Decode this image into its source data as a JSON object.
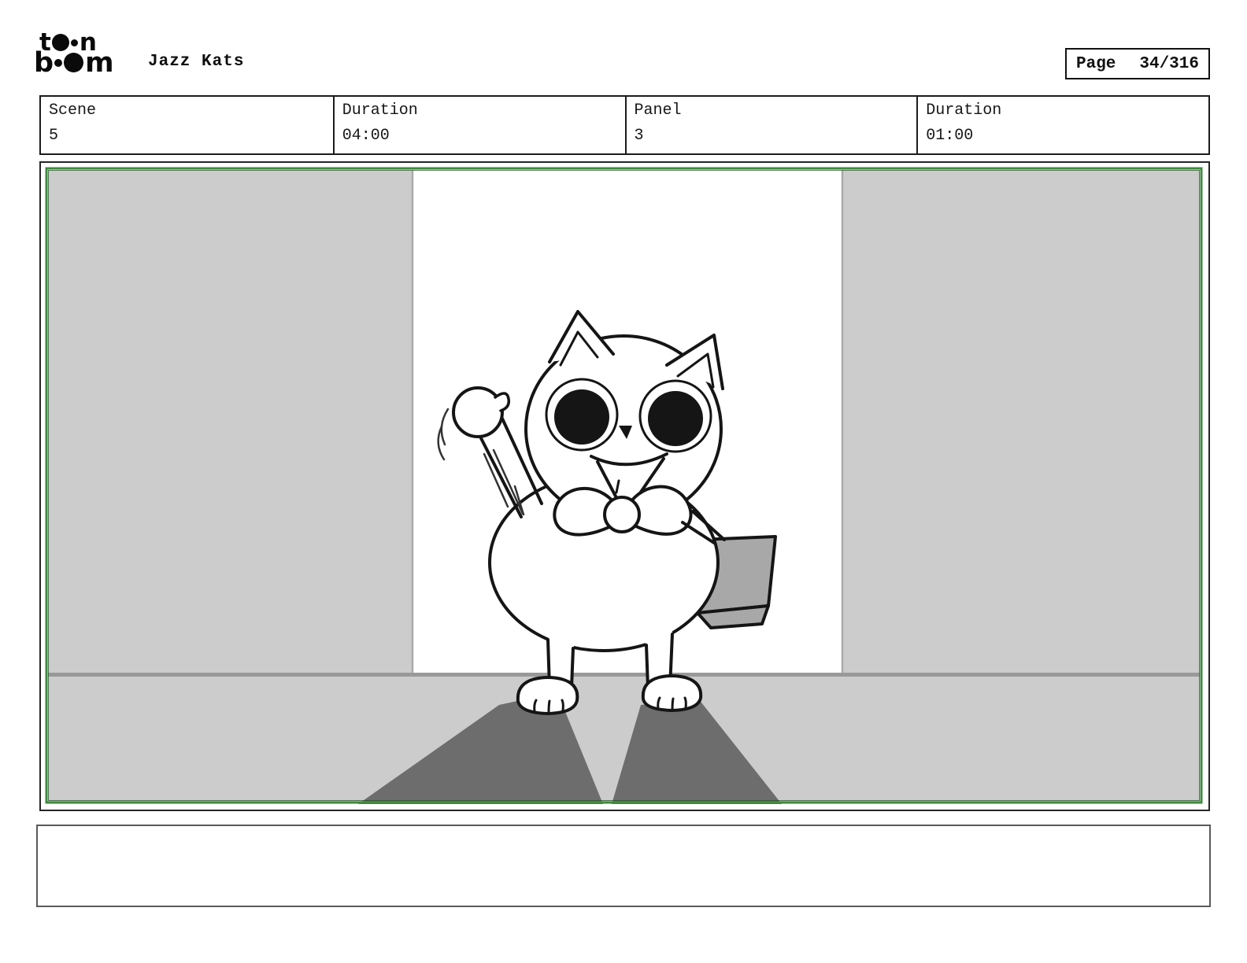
{
  "header": {
    "logo": {
      "row1_left": "t",
      "row1_right": "n",
      "row2_left": "b",
      "row2_right": "m"
    },
    "title": "Jazz Kats",
    "page": {
      "label": "Page",
      "value": "34/316"
    }
  },
  "info_table": {
    "cells": [
      {
        "label": "Scene",
        "value": "5"
      },
      {
        "label": "Duration",
        "value": "04:00"
      },
      {
        "label": "Panel",
        "value": "3"
      },
      {
        "label": "Duration",
        "value": "01:00"
      }
    ]
  },
  "panel": {
    "colors": {
      "camera_frame_green": "#3d8b3d",
      "camera_frame_inner_green": "#1e4f1e",
      "wall_gray": "#cccccc",
      "floor_line_gray": "#999999",
      "door_edge_gray": "#aaaaaa",
      "shadow_gray": "#6d6d6d",
      "bag_gray": "#a8a8a8",
      "ink": "#151515",
      "motion_line_gray": "#333333"
    }
  },
  "caption": {
    "text": ""
  }
}
